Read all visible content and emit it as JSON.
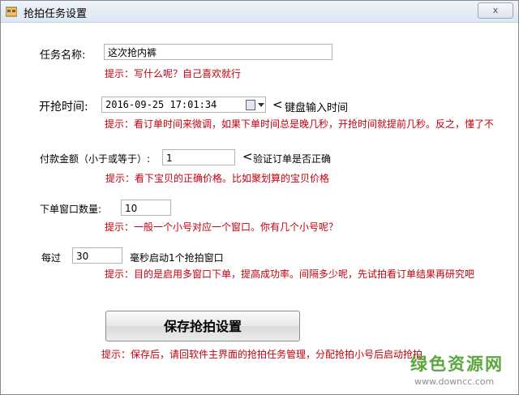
{
  "window": {
    "title": "抢拍任务设置",
    "close_label": "x"
  },
  "task_name": {
    "label": "任务名称:",
    "value": "这次抢内裤",
    "hint": "提示：写什么呢？自己喜欢就行"
  },
  "start_time": {
    "label": "开抢时间:",
    "value": "2016-09-25 17:01:34",
    "note": "键盘输入时间",
    "arrow": "<",
    "hint": "提示：看订单时间来微调，如果下单时间总是晚几秒，开抢时间就提前几秒。反之，懂了不"
  },
  "payment": {
    "label": "付款金额（小于或等于）:",
    "value": "1",
    "note": "验证订单是否正确",
    "arrow": "<",
    "hint": "提示：看下宝贝的正确价格。比如聚划算的宝贝价格"
  },
  "windows_count": {
    "label": "下单窗口数量:",
    "value": "10",
    "hint": "提示：一般一个小号对应一个窗口。你有几个小号呢？"
  },
  "interval": {
    "label": "每过",
    "value": "30",
    "suffix": "毫秒启动1个抢拍窗口",
    "hint": "提示：目的是启用多窗口下单，提高成功率。间隔多少呢，先试拍看订单结果再研究吧"
  },
  "save": {
    "label": "保存抢拍设置",
    "hint": "提示：保存后，请回软件主界面的抢拍任务管理，分配抢拍小号后启动抢拍"
  },
  "watermark": {
    "text": "绿色资源网",
    "url": "www.downcc.com"
  }
}
